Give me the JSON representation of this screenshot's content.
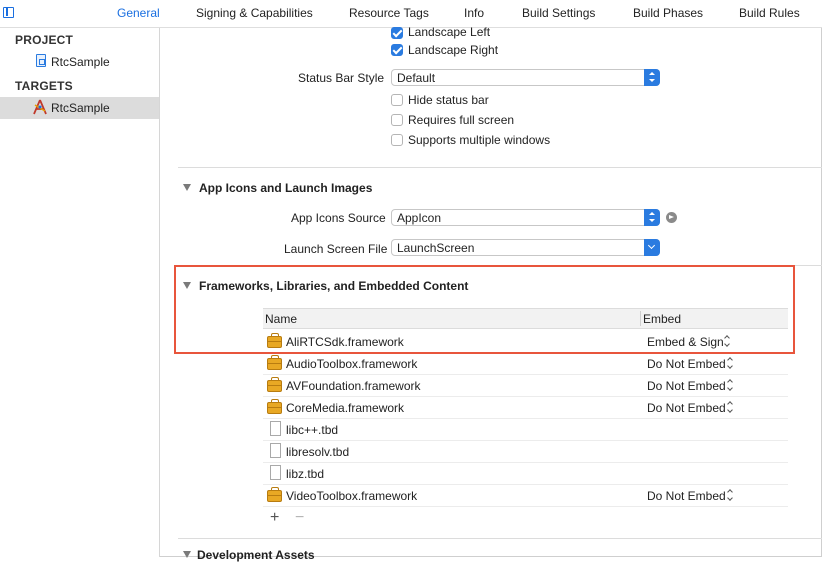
{
  "tabs": [
    {
      "label": "General",
      "active": true
    },
    {
      "label": "Signing & Capabilities"
    },
    {
      "label": "Resource Tags"
    },
    {
      "label": "Info"
    },
    {
      "label": "Build Settings"
    },
    {
      "label": "Build Phases"
    },
    {
      "label": "Build Rules"
    }
  ],
  "sidebar": {
    "project_header": "PROJECT",
    "project_item": "RtcSample",
    "targets_header": "TARGETS",
    "target_item": "RtcSample"
  },
  "orientation": {
    "landscape_left": "Landscape Left",
    "landscape_right": "Landscape Right"
  },
  "status_bar": {
    "label": "Status Bar Style",
    "value": "Default",
    "hide": "Hide status bar",
    "full_screen": "Requires full screen",
    "multi_windows": "Supports multiple windows"
  },
  "app_icons": {
    "title": "App Icons and Launch Images",
    "source_label": "App Icons Source",
    "source_value": "AppIcon",
    "launch_label": "Launch Screen File",
    "launch_value": "LaunchScreen"
  },
  "frameworks": {
    "title": "Frameworks, Libraries, and Embedded Content",
    "col_name": "Name",
    "col_embed": "Embed",
    "rows": [
      {
        "name": "AliRTCSdk.framework",
        "embed": "Embed & Sign",
        "kind": "framework"
      },
      {
        "name": "AudioToolbox.framework",
        "embed": "Do Not Embed",
        "kind": "framework"
      },
      {
        "name": "AVFoundation.framework",
        "embed": "Do Not Embed",
        "kind": "framework"
      },
      {
        "name": "CoreMedia.framework",
        "embed": "Do Not Embed",
        "kind": "framework"
      },
      {
        "name": "libc++.tbd",
        "embed": "",
        "kind": "file"
      },
      {
        "name": "libresolv.tbd",
        "embed": "",
        "kind": "file"
      },
      {
        "name": "libz.tbd",
        "embed": "",
        "kind": "file"
      },
      {
        "name": "VideoToolbox.framework",
        "embed": "Do Not Embed",
        "kind": "framework"
      }
    ],
    "add": "+",
    "remove": "−"
  },
  "next_section": "Development Assets",
  "colors": {
    "accent": "#1a6fe0",
    "highlight": "#e8553c",
    "framework_icon": "#e8a824"
  }
}
